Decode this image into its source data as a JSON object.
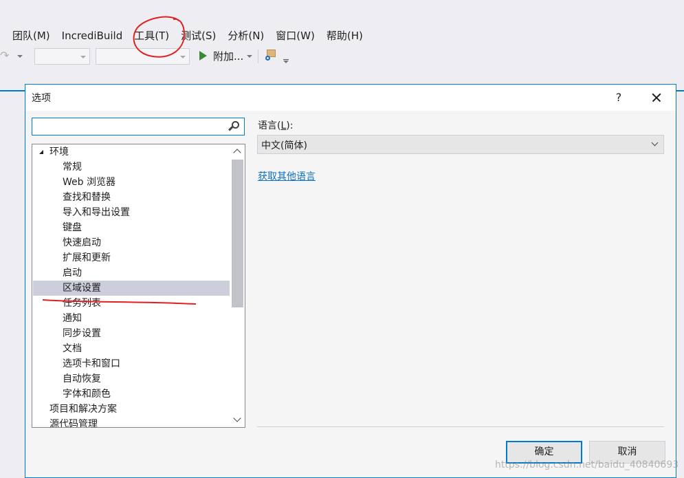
{
  "menubar": {
    "items": [
      "团队(M)",
      "IncrediBuild",
      "工具(T)",
      "测试(S)",
      "分析(N)",
      "窗口(W)",
      "帮助(H)"
    ]
  },
  "toolbar": {
    "attach_label": "附加...",
    "icons": [
      "redo-icon",
      "start-icon",
      "find-in-files-icon"
    ]
  },
  "dialog": {
    "title": "选项",
    "help_label": "?",
    "search": {
      "value": "",
      "placeholder": ""
    },
    "tree": [
      {
        "label": "环境",
        "level": 0,
        "expanded": true
      },
      {
        "label": "常规",
        "level": 1
      },
      {
        "label": "Web 浏览器",
        "level": 1
      },
      {
        "label": "查找和替换",
        "level": 1
      },
      {
        "label": "导入和导出设置",
        "level": 1
      },
      {
        "label": "键盘",
        "level": 1
      },
      {
        "label": "快速启动",
        "level": 1
      },
      {
        "label": "扩展和更新",
        "level": 1
      },
      {
        "label": "启动",
        "level": 1
      },
      {
        "label": "区域设置",
        "level": 1,
        "selected": true
      },
      {
        "label": "任务列表",
        "level": 1
      },
      {
        "label": "通知",
        "level": 1
      },
      {
        "label": "同步设置",
        "level": 1
      },
      {
        "label": "文档",
        "level": 1
      },
      {
        "label": "选项卡和窗口",
        "level": 1
      },
      {
        "label": "自动恢复",
        "level": 1
      },
      {
        "label": "字体和颜色",
        "level": 1
      },
      {
        "label": "项目和解决方案",
        "level": 0,
        "expanded": false
      },
      {
        "label": "源代码管理",
        "level": 0,
        "expanded": false
      }
    ],
    "language": {
      "label_prefix": "语言(",
      "label_key": "L",
      "label_suffix": "):",
      "selected": "中文(简体)",
      "link": "获取其他语言"
    },
    "ok_label": "确定",
    "cancel_label": "取消"
  },
  "watermark": "https://blog.csdn.net/baidu_40840693",
  "colors": {
    "accent": "#007acc",
    "selection": "#cccedb",
    "link": "#0e70c0",
    "annotation": "#e02020"
  }
}
